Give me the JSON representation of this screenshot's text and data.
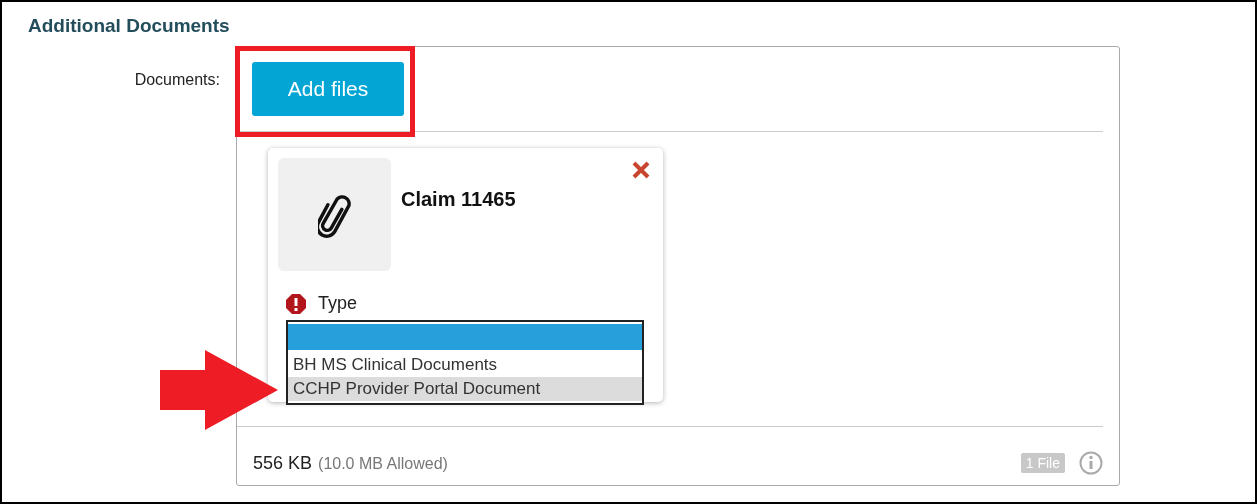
{
  "section": {
    "title": "Additional Documents"
  },
  "field": {
    "label": "Documents:"
  },
  "add_button": {
    "label": "Add files"
  },
  "file_card": {
    "name": "Claim 11465",
    "type_label": "Type",
    "type_required_error": true,
    "type_options": [
      {
        "selected": true,
        "hovered": false
      },
      {
        "label": "BH MS Clinical Documents",
        "selected": false,
        "hovered": false
      },
      {
        "label": "CCHP Provider Portal Document",
        "selected": false,
        "hovered": true
      }
    ]
  },
  "footer": {
    "size": "556 KB",
    "allowed": "(10.0 MB Allowed)",
    "count_badge": "1 File"
  }
}
